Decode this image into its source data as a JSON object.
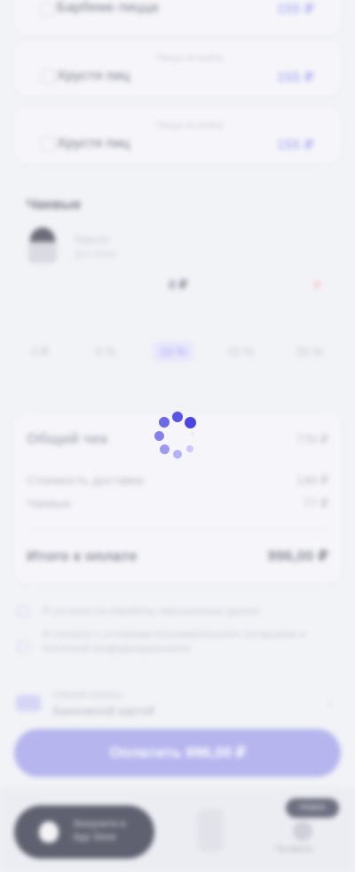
{
  "list_rows": [
    {
      "title": "Барбекю пицца",
      "price": "155 ₽",
      "note": ""
    },
    {
      "title": "Хрустя пиц",
      "price": "155 ₽",
      "note": "Пицца на выбор"
    },
    {
      "title": "Хрустя пиц",
      "price": "155 ₽",
      "note": "Пицца на выбор"
    }
  ],
  "tips": {
    "title": "Чаевые",
    "courier_name": "Курьер",
    "courier_role": "Доставка",
    "center_value": "0 ₽",
    "remove_label": "✕",
    "options": [
      "0 ₽",
      "5 %",
      "10 %",
      "15 %",
      "20 %"
    ],
    "selected_index": 2
  },
  "summary": {
    "title": "Общий чек",
    "title_value": "770 ₽",
    "rows": [
      {
        "label": "Стоимость доставки",
        "value": "149 ₽"
      },
      {
        "label": "Чаевые",
        "value": "77 ₽"
      }
    ],
    "total_label": "Итого к оплате",
    "total_value": "996,00 ₽"
  },
  "consents": [
    "Я согласен на обработку персональных данных",
    "Я согласен с условиями пользовательского соглашения и политикой конфиденциальности"
  ],
  "payment": {
    "method_title": "Способ оплаты",
    "method_value": "Банковской картой"
  },
  "pay_button": "Оплатить 996,00 ₽",
  "bottom": {
    "store_label": "Загрузите в App Store",
    "badge": "Новое",
    "profile_label": "Профиль"
  },
  "colors": {
    "accent": "#4b45e4",
    "accent_light": "#b6b5ee"
  }
}
